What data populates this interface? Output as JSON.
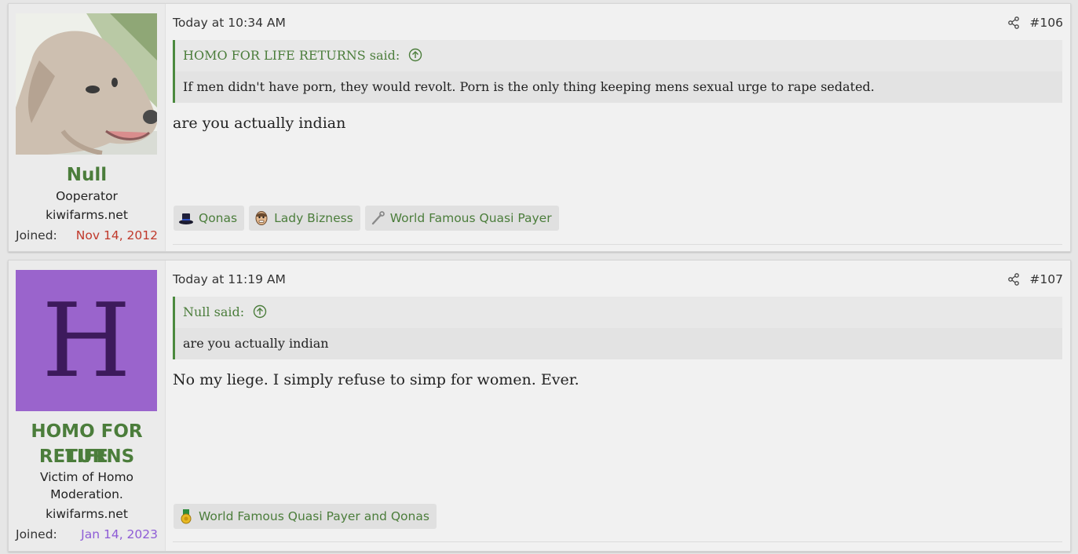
{
  "posts": [
    {
      "user": {
        "name": "Null",
        "title_lines": [
          "Ooperator"
        ],
        "site": "kiwifarms.net",
        "joined_label": "Joined:",
        "joined_date": "Nov 14, 2012",
        "joined_color": "#c0392b"
      },
      "timestamp": "Today at 10:34 AM",
      "post_number": "#106",
      "quote": {
        "author": "HOMO FOR LIFE RETURNS said:",
        "text": "If men didn't have porn, they would revolt. Porn is the only thing keeping mens sexual urge to rape sedated."
      },
      "message": "are you actually indian",
      "reactions": [
        {
          "icon": "top-hat-icon",
          "label": "Qonas"
        },
        {
          "icon": "face-icon",
          "label": "Lady Bizness"
        },
        {
          "icon": "wrench-icon",
          "label": "World Famous Quasi Payer"
        }
      ]
    },
    {
      "user": {
        "name_lines": [
          "HOMO FOR LIFE",
          "RETURNS"
        ],
        "avatar_letter": "H",
        "title_lines": [
          "Victim of Homo",
          "Moderation."
        ],
        "site": "kiwifarms.net",
        "joined_label": "Joined:",
        "joined_date": "Jan 14, 2023",
        "joined_color": "#8e5cd6"
      },
      "timestamp": "Today at 11:19 AM",
      "post_number": "#107",
      "quote": {
        "author": "Null said:",
        "text": "are you actually indian"
      },
      "message": "No my liege. I simply refuse to simp for women. Ever.",
      "reactions": [
        {
          "icon": "medal-icon",
          "label": "World Famous Quasi Payer and Qonas"
        }
      ]
    }
  ],
  "colors": {
    "accent_green": "#4b7d3b",
    "quote_border": "#4b8a3e",
    "avatar_purple": "#9a64cc"
  }
}
